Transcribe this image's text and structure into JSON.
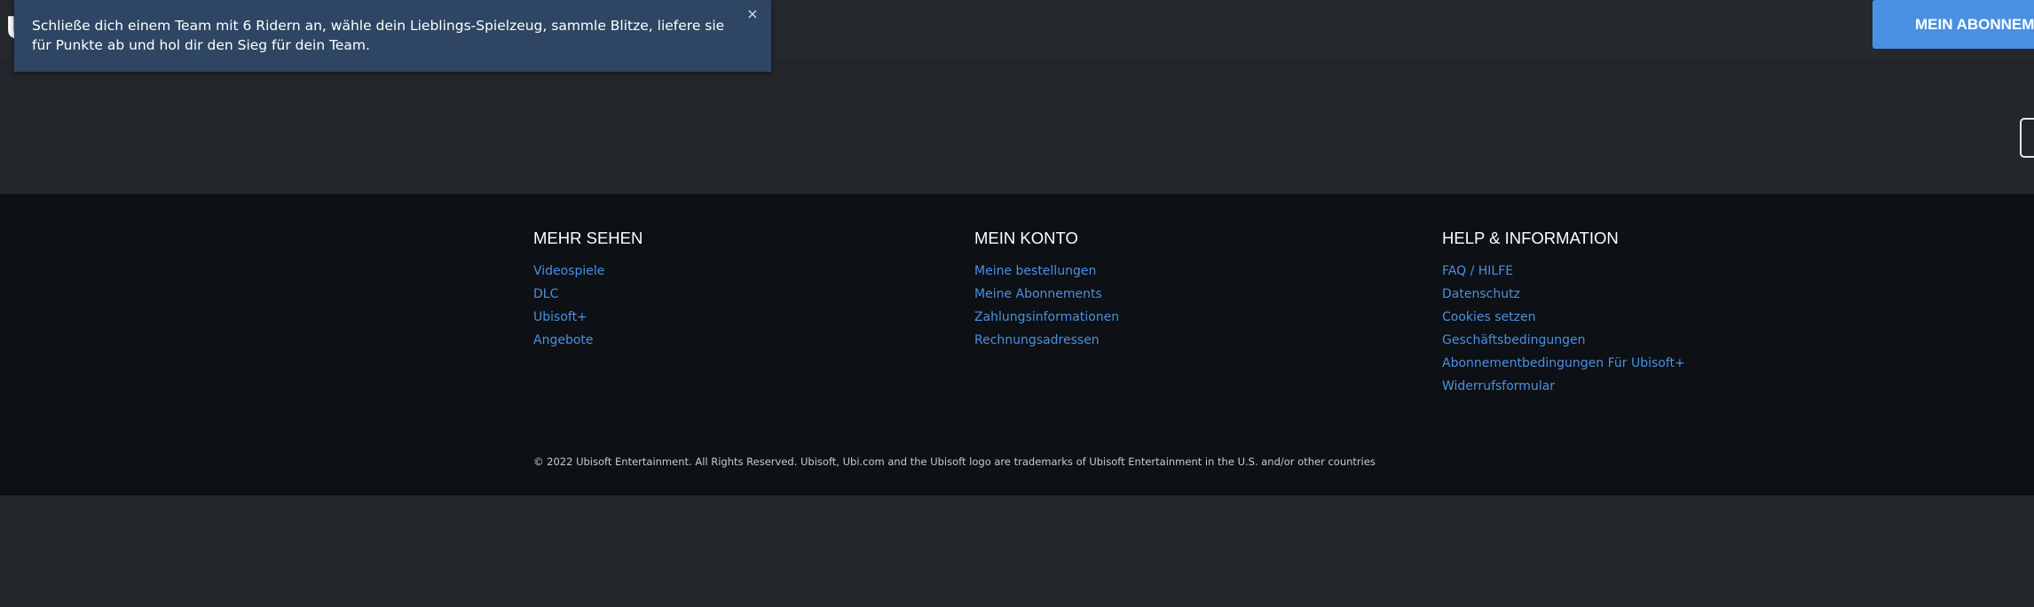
{
  "header": {
    "logo_text": "U",
    "subscribe_label": "MEIN ABONNEMENT"
  },
  "toast": {
    "text": "Schließe dich einem Team mit 6 Ridern an, wähle dein Lieblings-Spielzeug, sammle Blitze, liefere sie für Punkte ab und hol dir den Sieg für dein Team.",
    "close_glyph": "×"
  },
  "footer": {
    "columns": [
      {
        "title": "MEHR SEHEN",
        "links": [
          "Videospiele",
          "DLC",
          "Ubisoft+",
          "Angebote"
        ]
      },
      {
        "title": "MEIN KONTO",
        "links": [
          "Meine bestellungen",
          "Meine Abonnements",
          "Zahlungsinformationen",
          "Rechnungsadressen"
        ]
      },
      {
        "title": "HELP & INFORMATION",
        "links": [
          "FAQ / HILFE",
          "Datenschutz",
          "Cookies setzen",
          "Geschäftsbedingungen",
          "Abonnementbedingungen Für Ubisoft+",
          "Widerrufsformular"
        ]
      }
    ],
    "copyright": "© 2022 Ubisoft Entertainment. All Rights Reserved. Ubisoft, Ubi.com and the Ubisoft logo are trademarks of Ubisoft Entertainment in the U.S. and/or other countries"
  },
  "colors": {
    "accent": "#4a90e2",
    "toast_bg": "#2e4663",
    "footer_bg": "#0d1014",
    "page_bg": "#23272c"
  }
}
